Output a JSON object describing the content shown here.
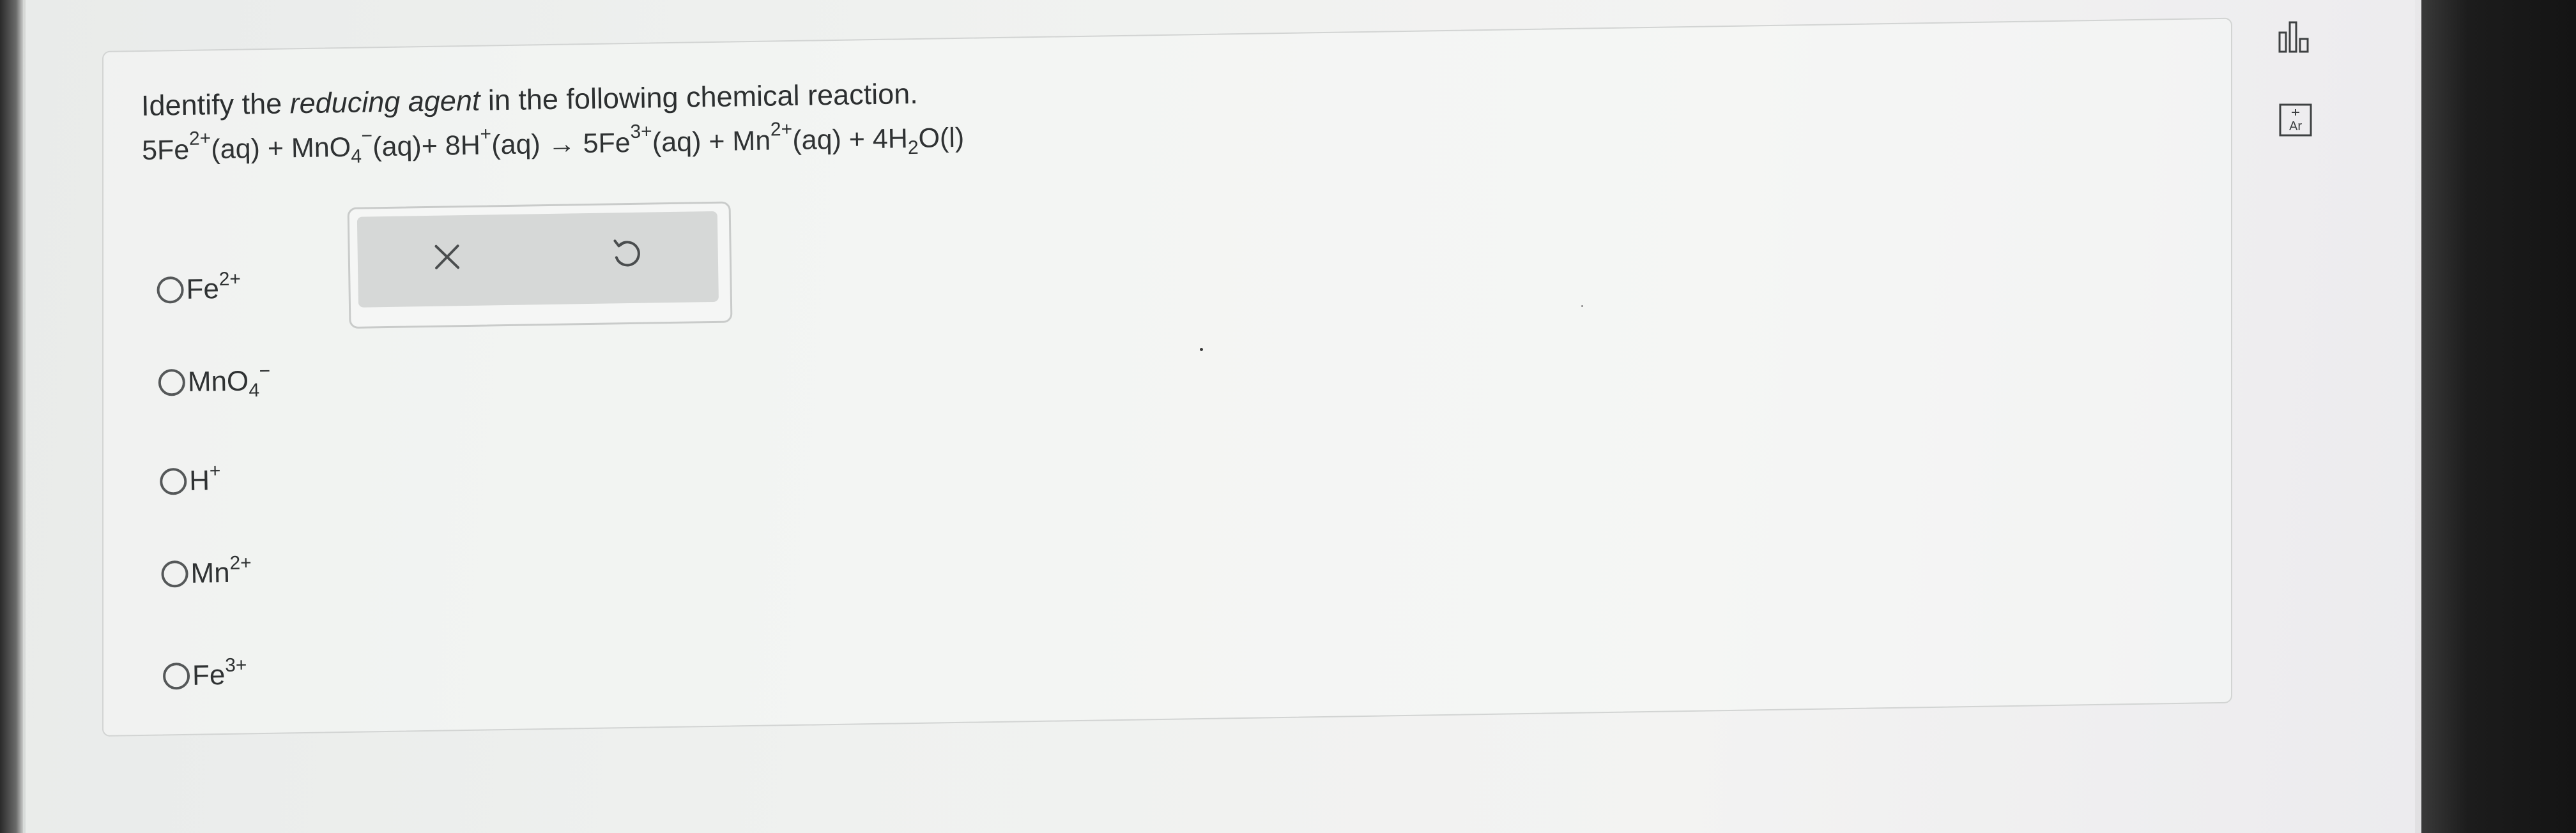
{
  "question": {
    "prefix": "Identify the ",
    "emphasis": "reducing agent",
    "suffix": " in the following chemical reaction."
  },
  "equation": {
    "c1": "5Fe",
    "c1_sup": "2+",
    "c1_state": "(aq) + MnO",
    "c2_sub": "4",
    "c2_sup": "−",
    "c2_state": "(aq)+ 8H",
    "c3_sup": "+",
    "c3_state": "(aq) → 5Fe",
    "c4_sup": "3+",
    "c4_state": "(aq) + Mn",
    "c5_sup": "2+",
    "c5_state": "(aq) + 4H",
    "c6_sub": "2",
    "c6_state": "O(l)"
  },
  "options": [
    {
      "base": "Fe",
      "sub": "",
      "sup": "2+"
    },
    {
      "base": "MnO",
      "sub": "4",
      "sup": "−"
    },
    {
      "base": "H",
      "sub": "",
      "sup": "+"
    },
    {
      "base": "Mn",
      "sub": "",
      "sup": "2+"
    },
    {
      "base": "Fe",
      "sub": "",
      "sup": "3+"
    }
  ],
  "action_box": {
    "clear_icon": "close-icon",
    "undo_icon": "undo-icon"
  },
  "tools": {
    "data_icon": "bar-chart-icon",
    "periodic_label": "Ar"
  },
  "colors": {
    "text": "#2c2f30",
    "radio_border": "#555859",
    "action_bg": "#d6d8d7"
  }
}
